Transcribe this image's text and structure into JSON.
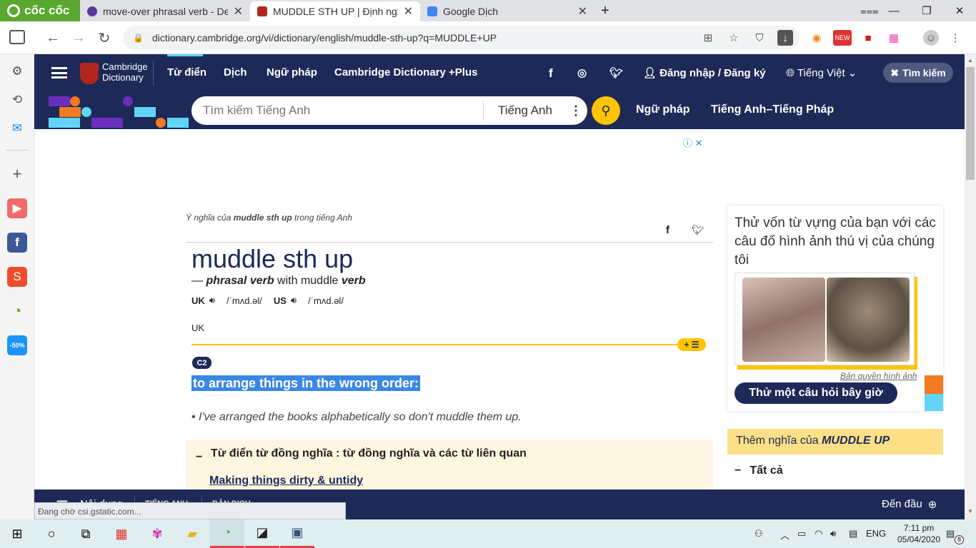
{
  "browser": {
    "brand": "cốc cốc",
    "tabs": [
      {
        "title": "move-over phrasal verb - Def",
        "active": false
      },
      {
        "title": "MUDDLE STH UP | Định nghĩa",
        "active": true
      },
      {
        "title": "Google Dịch",
        "active": false
      }
    ],
    "url": "dictionary.cambridge.org/vi/dictionary/english/muddle-sth-up?q=MUDDLE+UP",
    "status": "Đang chờ csi.gstatic.com..."
  },
  "site": {
    "logo_line1": "Cambridge",
    "logo_line2": "Dictionary",
    "nav": [
      "Từ điển",
      "Dịch",
      "Ngữ pháp",
      "Cambridge Dictionary +Plus"
    ],
    "login": "Đăng nhập / Đăng ký",
    "language": "Tiếng Việt",
    "search_btn": "Tìm kiếm",
    "search_placeholder": "Tìm kiếm Tiếng Anh",
    "search_lang": "Tiếng Anh",
    "sub_links": [
      "Ngữ pháp",
      "Tiếng Anh–Tiếng Pháp"
    ]
  },
  "entry": {
    "crumb_prefix": "Ý nghĩa của ",
    "crumb_word": "muddle sth up",
    "crumb_suffix": " trong tiếng Anh",
    "headword": "muddle sth up",
    "pos_dash": "— ",
    "pos": "phrasal verb",
    "pos_with": " with muddle ",
    "pos_verb": "verb",
    "uk_label": "UK",
    "uk_ipa": "/ˈmʌd.əl/",
    "us_label": "US",
    "us_ipa": "/ˈmʌd.əl/",
    "region": "UK",
    "level": "C2",
    "definition": "to arrange things in the wrong order:",
    "example": "I've arranged the books alphabetically so don't muddle them up.",
    "thesaurus_title": "Từ điển từ đồng nghĩa : từ đồng nghĩa và các từ liên quan",
    "thesaurus_link": "Making things dirty & untidy"
  },
  "sidebar_right": {
    "quiz_title": "Thử vốn từ vựng của bạn với các câu đố hình ảnh thú vị của chúng tôi",
    "copyright": "Bản quyền hình ảnh",
    "quiz_button": "Thử một câu hỏi bây giờ",
    "more_prefix": "Thêm nghĩa của ",
    "more_word": "MUDDLE UP",
    "all_label": "Tất cả"
  },
  "bottom_bar": {
    "contents": "Nội dung",
    "tab1": "TIẾNG ANH",
    "tab2": "BẢN DỊCH",
    "to_top": "Đến đầu"
  },
  "taskbar": {
    "lang": "ENG",
    "time": "7:11 pm",
    "date": "05/04/2020",
    "notif_count": "8"
  }
}
